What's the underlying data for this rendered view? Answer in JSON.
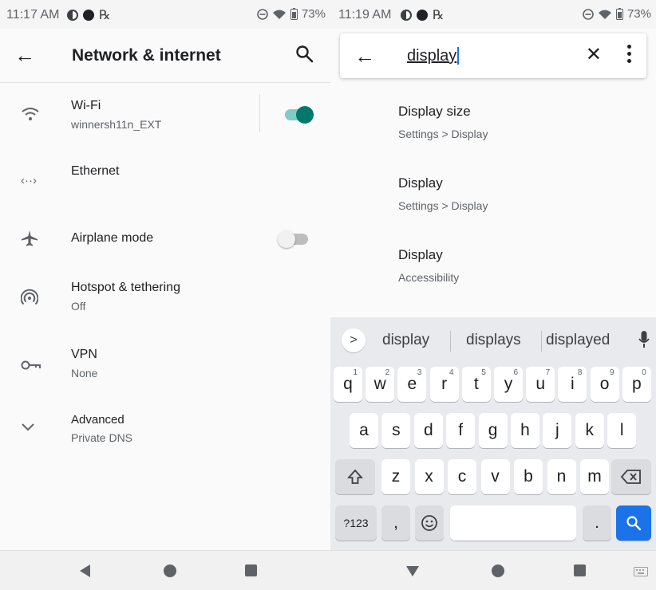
{
  "left": {
    "status": {
      "time": "11:17 AM",
      "battery": "73%"
    },
    "appbar": {
      "title": "Network & internet"
    },
    "items": [
      {
        "title": "Wi-Fi",
        "subtitle": "winnersh11n_EXT",
        "toggle": "on"
      },
      {
        "title": "Ethernet",
        "subtitle": ""
      },
      {
        "title": "Airplane mode",
        "subtitle": "",
        "toggle": "off"
      },
      {
        "title": "Hotspot & tethering",
        "subtitle": "Off"
      },
      {
        "title": "VPN",
        "subtitle": "None"
      },
      {
        "title": "Advanced",
        "subtitle": "Private DNS"
      }
    ],
    "icons": {
      "wifi": "<·>",
      "ethernet": "‹··›",
      "airplane": "✈"
    }
  },
  "right": {
    "status": {
      "time": "11:19 AM",
      "battery": "73%"
    },
    "search": {
      "query": "display"
    },
    "results": [
      {
        "title": "Display size",
        "path": "Settings > Display"
      },
      {
        "title": "Display",
        "path": "Settings > Display"
      },
      {
        "title": "Display",
        "path": "Accessibility"
      }
    ],
    "keyboard": {
      "suggestions": [
        "display",
        "displays",
        "displayed"
      ],
      "expand_glyph": ">",
      "row1": [
        {
          "k": "q",
          "n": "1"
        },
        {
          "k": "w",
          "n": "2"
        },
        {
          "k": "e",
          "n": "3"
        },
        {
          "k": "r",
          "n": "4"
        },
        {
          "k": "t",
          "n": "5"
        },
        {
          "k": "y",
          "n": "6"
        },
        {
          "k": "u",
          "n": "7"
        },
        {
          "k": "i",
          "n": "8"
        },
        {
          "k": "o",
          "n": "9"
        },
        {
          "k": "p",
          "n": "0"
        }
      ],
      "row2": [
        "a",
        "s",
        "d",
        "f",
        "g",
        "h",
        "j",
        "k",
        "l"
      ],
      "row3": [
        "z",
        "x",
        "c",
        "v",
        "b",
        "n",
        "m"
      ],
      "symbols_label": "?123",
      "comma": ",",
      "period": ".",
      "accent": "#1a73e8"
    }
  }
}
